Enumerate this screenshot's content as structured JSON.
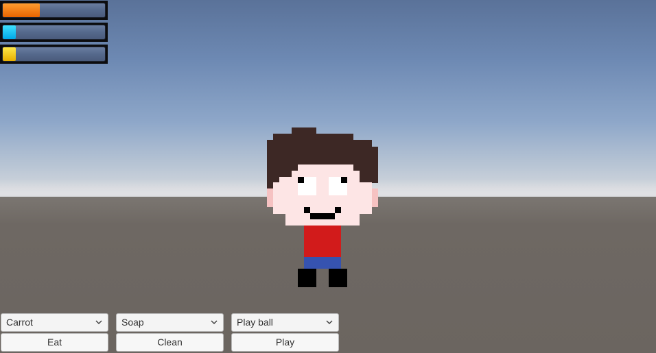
{
  "status_bars": [
    {
      "id": "hunger",
      "level": 0.36,
      "color": "#f07800"
    },
    {
      "id": "hygiene",
      "level": 0.13,
      "color": "#00c0f0"
    },
    {
      "id": "fun",
      "level": 0.13,
      "color": "#f0c800"
    }
  ],
  "controls": [
    {
      "select_value": "Carrot",
      "button_label": "Eat"
    },
    {
      "select_value": "Soap",
      "button_label": "Clean"
    },
    {
      "select_value": "Play ball",
      "button_label": "Play"
    }
  ],
  "colors": {
    "hair": "#3d2825",
    "skin": "#fde5e5",
    "shirt": "#d21b1b",
    "pants": "#3653b0"
  },
  "icons": {
    "dropdown_arrow": "chevron-down-icon"
  }
}
